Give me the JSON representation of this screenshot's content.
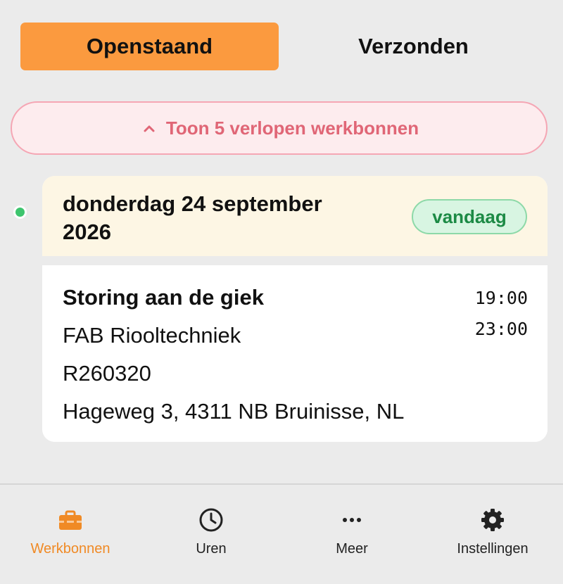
{
  "tabs": [
    {
      "label": "Openstaand",
      "active": true
    },
    {
      "label": "Verzonden",
      "active": false
    }
  ],
  "expired_toggle": {
    "label": "Toon 5 verlopen werkbonnen",
    "icon": "chevron-up-icon",
    "color": "#e06676"
  },
  "day": {
    "title": "donderdag 24 september 2026",
    "badge": "vandaag",
    "status_dot_color": "#3ec56e"
  },
  "job": {
    "title": "Storing aan de giek",
    "company": "FAB Riooltechniek",
    "reference": "R260320",
    "address": "Hageweg 3, 4311 NB Bruinisse, NL",
    "start_time": "19:00",
    "end_time": "23:00"
  },
  "nav": [
    {
      "label": "Werkbonnen",
      "icon": "briefcase-icon",
      "active": true
    },
    {
      "label": "Uren",
      "icon": "clock-icon",
      "active": false
    },
    {
      "label": "Meer",
      "icon": "more-dots-icon",
      "active": false
    },
    {
      "label": "Instellingen",
      "icon": "gear-icon",
      "active": false
    }
  ],
  "colors": {
    "accent": "#fb9a3f",
    "background": "#ebebeb",
    "today_badge": "#1c8a45"
  }
}
